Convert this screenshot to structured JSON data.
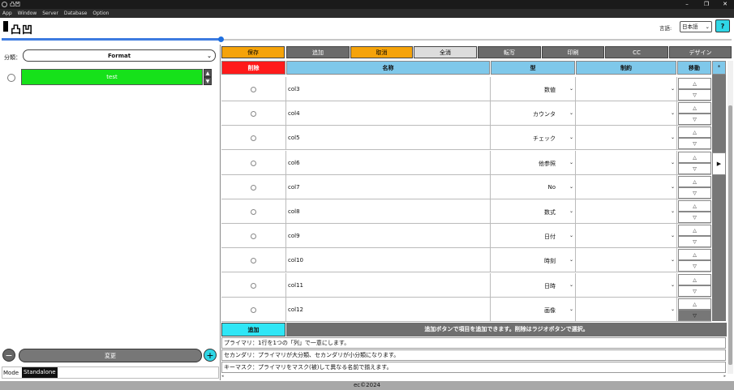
{
  "window": {
    "title": "凸凹"
  },
  "menu": [
    "App",
    "Window",
    "Server",
    "Database",
    "Option"
  ],
  "header": {
    "logo": "凸凹",
    "language_label": "言語:",
    "language_value": "日本語",
    "help": "?",
    "progress_fraction": 0.3
  },
  "left": {
    "category_label": "分類：",
    "category_value": "Format",
    "item": "test",
    "change_label": "変更",
    "minus": "−",
    "plus": "+",
    "mode_label": "Mode",
    "mode_value": "Standalone"
  },
  "toolbar": [
    {
      "label": "保存",
      "color": "#f5a30a"
    },
    {
      "label": "追加",
      "color": "#6b6b6b"
    },
    {
      "label": "取消",
      "color": "#f5a30a"
    },
    {
      "label": "全消",
      "color": "#dcdcdc"
    },
    {
      "label": "転写",
      "color": "#6b6b6b"
    },
    {
      "label": "印刷",
      "color": "#6b6b6b"
    },
    {
      "label": "CC",
      "color": "#6b6b6b"
    },
    {
      "label": "デザイン",
      "color": "#6b6b6b"
    }
  ],
  "table": {
    "headers": {
      "delete": "削除",
      "name": "名称",
      "type": "型",
      "constraint": "制約",
      "move": "移動",
      "extra": "*"
    },
    "rows": [
      {
        "name": "col3",
        "type": "数値"
      },
      {
        "name": "col4",
        "type": "カウンタ"
      },
      {
        "name": "col5",
        "type": "チェック"
      },
      {
        "name": "col6",
        "type": "他参照"
      },
      {
        "name": "col7",
        "type": "No"
      },
      {
        "name": "col8",
        "type": "数式"
      },
      {
        "name": "col9",
        "type": "日付"
      },
      {
        "name": "col10",
        "type": "時刻"
      },
      {
        "name": "col11",
        "type": "日時"
      },
      {
        "name": "col12",
        "type": "画像"
      }
    ],
    "move_up": "△",
    "move_down": "▽",
    "expand_arrow": "▶"
  },
  "add_button": "追加",
  "add_message": "追加ボタンで項目を追加できます。削除はラジオボタンで選択。",
  "notes": [
    "プライマリ：1行を1つの「列」で一意にします。",
    "セカンダリ：プライマリが大分類、セカンダリが小分類になります。",
    "キーマスク：プライマリをマスク(被)して異なる名前で揃えます。"
  ],
  "footer": "ec©2024",
  "colors": {
    "accent": "#2fe6f6",
    "delete": "#ff1a1a",
    "header_blue": "#7fc8ea",
    "item_green": "#16e11a"
  }
}
